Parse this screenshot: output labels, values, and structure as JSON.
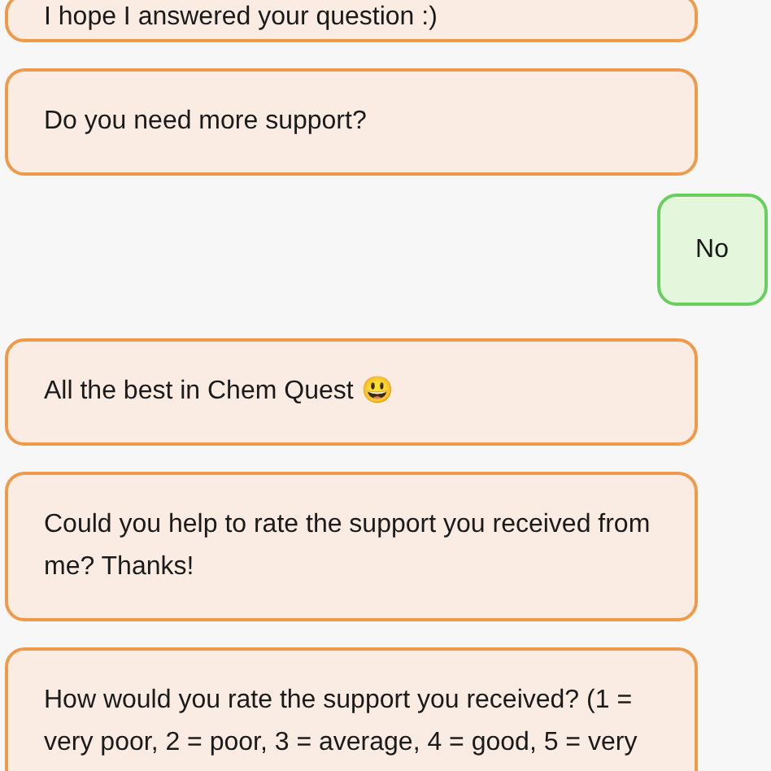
{
  "messages": [
    {
      "kind": "bot",
      "text": "I hope I answered your question :)"
    },
    {
      "kind": "bot",
      "text": "Do you need more support?"
    },
    {
      "kind": "user",
      "text": "No"
    },
    {
      "kind": "bot",
      "text": "All the best in Chem Quest 😃"
    },
    {
      "kind": "bot",
      "text": "Could you help to rate the support you received from me? Thanks!"
    },
    {
      "kind": "bot",
      "text": "How would you rate the support you received? (1 = very poor, 2 = poor, 3 = average, 4 = good, 5 = very"
    }
  ]
}
